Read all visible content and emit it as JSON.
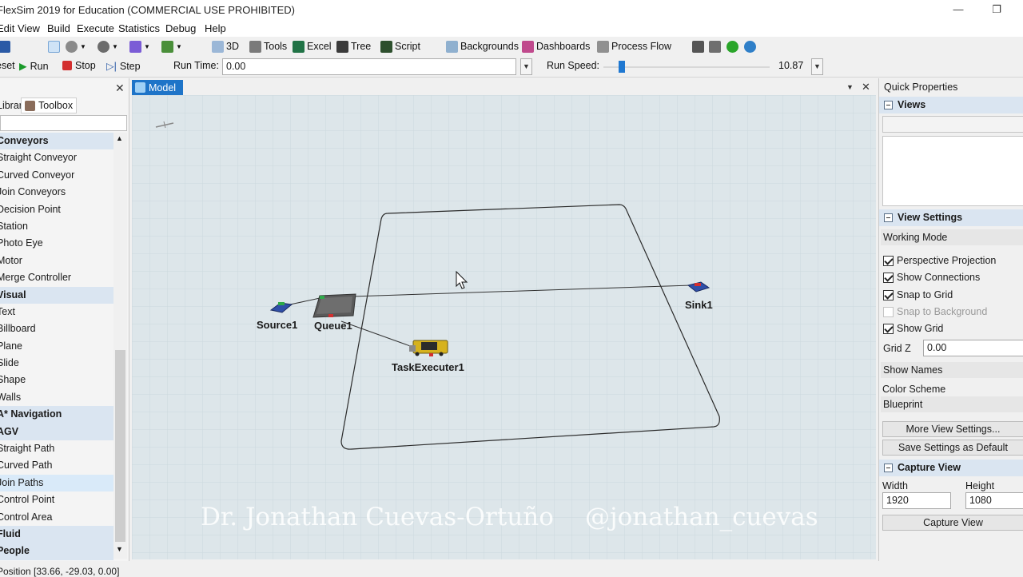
{
  "window": {
    "title": "FlexSim 2019 for Education (COMMERCIAL USE PROHIBITED)",
    "minimize": "—",
    "maximize": "❐"
  },
  "menu": [
    "Edit",
    "View",
    "Build",
    "Execute",
    "Statistics",
    "Debug",
    "Help"
  ],
  "toolbar": {
    "view3d": "3D",
    "tools": "Tools",
    "excel": "Excel",
    "tree": "Tree",
    "script": "Script",
    "backgrounds": "Backgrounds",
    "dashboards": "Dashboards",
    "process_flow": "Process Flow"
  },
  "run": {
    "reset": "Reset",
    "run": "Run",
    "stop": "Stop",
    "step": "Step",
    "run_time_label": "Run Time:",
    "run_time_value": "0.00",
    "run_speed_label": "Run Speed:",
    "run_speed_value": "10.87"
  },
  "library": {
    "tab_library": "Library",
    "tab_toolbox": "Toolbox",
    "items": [
      {
        "label": "Conveyors",
        "type": "head"
      },
      {
        "label": "Straight Conveyor",
        "type": "item"
      },
      {
        "label": "Curved Conveyor",
        "type": "item"
      },
      {
        "label": "Join Conveyors",
        "type": "item"
      },
      {
        "label": "Decision Point",
        "type": "item"
      },
      {
        "label": "Station",
        "type": "item"
      },
      {
        "label": "Photo Eye",
        "type": "item"
      },
      {
        "label": "Motor",
        "type": "item"
      },
      {
        "label": "Merge Controller",
        "type": "item"
      },
      {
        "label": "Visual",
        "type": "head"
      },
      {
        "label": "Text",
        "type": "item"
      },
      {
        "label": "Billboard",
        "type": "item"
      },
      {
        "label": "Plane",
        "type": "item"
      },
      {
        "label": "Slide",
        "type": "item"
      },
      {
        "label": "Shape",
        "type": "item"
      },
      {
        "label": "Walls",
        "type": "item"
      },
      {
        "label": "A* Navigation",
        "type": "head"
      },
      {
        "label": "AGV",
        "type": "head"
      },
      {
        "label": "Straight Path",
        "type": "item"
      },
      {
        "label": "Curved Path",
        "type": "item"
      },
      {
        "label": "Join Paths",
        "type": "sel"
      },
      {
        "label": "Control Point",
        "type": "item"
      },
      {
        "label": "Control Area",
        "type": "item"
      },
      {
        "label": "Fluid",
        "type": "head"
      },
      {
        "label": "People",
        "type": "head"
      }
    ]
  },
  "model": {
    "tab": "Model",
    "objects": {
      "source": "Source1",
      "queue": "Queue1",
      "sink": "Sink1",
      "executer": "TaskExecuter1"
    },
    "watermark_left": "Dr. Jonathan Cuevas-Ortuño",
    "watermark_right": "@jonathan_cuevas"
  },
  "quick": {
    "title": "Quick Properties",
    "views_head": "Views",
    "view_settings_head": "View Settings",
    "working_mode": "Working Mode",
    "checks": [
      {
        "label": "Perspective Projection",
        "on": true,
        "disabled": false
      },
      {
        "label": "Show Connections",
        "on": true,
        "disabled": false
      },
      {
        "label": "Snap to Grid",
        "on": true,
        "disabled": false
      },
      {
        "label": "Snap to Background",
        "on": false,
        "disabled": true
      },
      {
        "label": "Show Grid",
        "on": true,
        "disabled": false
      }
    ],
    "grid_z_label": "Grid Z",
    "grid_z_value": "0.00",
    "show_names": "Show Names",
    "color_scheme_label": "Color Scheme",
    "color_scheme_value": "Blueprint",
    "more_settings": "More View Settings...",
    "save_default": "Save Settings as Default",
    "capture_head": "Capture View",
    "width_label": "Width",
    "width_value": "1920",
    "height_label": "Height",
    "height_value": "1080",
    "capture_btn": "Capture View"
  },
  "status": {
    "position": "Position [33.66, -29.03, 0.00]"
  },
  "colors": {
    "accent": "#1e74c8",
    "section_head": "#dae5f1",
    "grid_bg": "#dde6ea"
  }
}
